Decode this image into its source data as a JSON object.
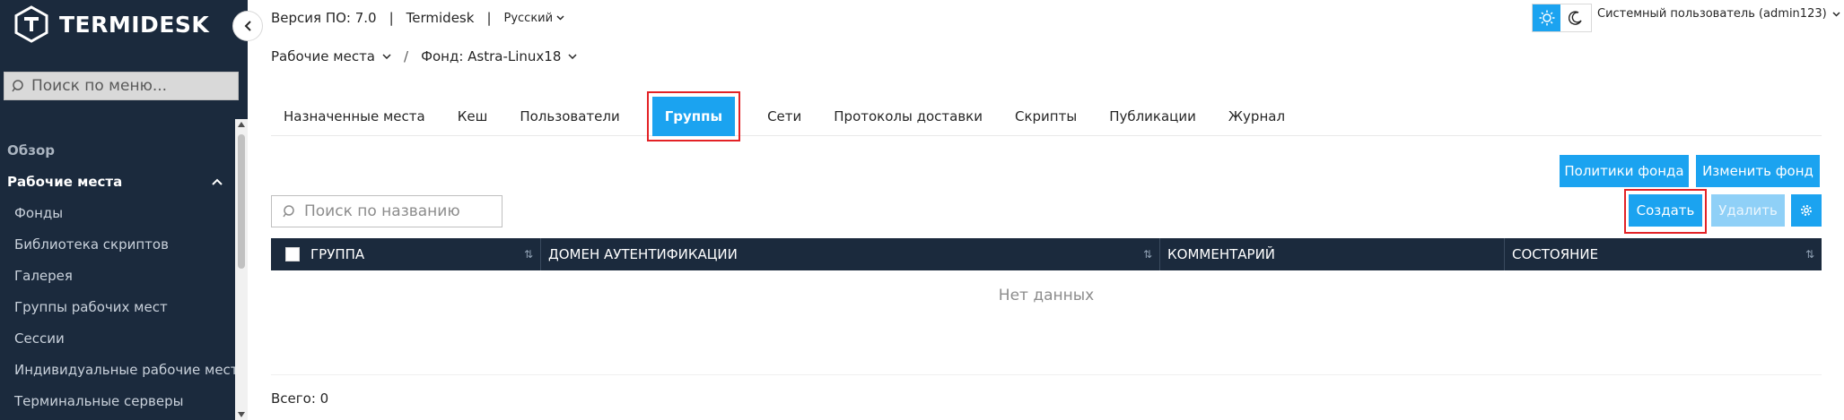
{
  "sidebar": {
    "logo_text": "TERMIDESK",
    "search_placeholder": "Поиск по меню...",
    "items": [
      {
        "label": "Обзор"
      },
      {
        "label": "Рабочие места"
      },
      {
        "label": "Фонды"
      },
      {
        "label": "Библиотека скриптов"
      },
      {
        "label": "Галерея"
      },
      {
        "label": "Группы рабочих мест"
      },
      {
        "label": "Сессии"
      },
      {
        "label": "Индивидуальные рабочие места"
      },
      {
        "label": "Терминальные серверы"
      }
    ]
  },
  "header": {
    "version": "Версия ПО: 7.0",
    "separator": "|",
    "product": "Termidesk",
    "language": "Русский",
    "user": "Системный пользователь (admin123)"
  },
  "breadcrumb": {
    "root": "Рабочие места",
    "current": "Фонд: Astra-Linux18",
    "separator": "/"
  },
  "tabs": [
    {
      "label": "Назначенные места"
    },
    {
      "label": "Кеш"
    },
    {
      "label": "Пользователи"
    },
    {
      "label": "Группы"
    },
    {
      "label": "Сети"
    },
    {
      "label": "Протоколы доставки"
    },
    {
      "label": "Скрипты"
    },
    {
      "label": "Публикации"
    },
    {
      "label": "Журнал"
    }
  ],
  "actions": {
    "policies": "Политики фонда",
    "edit": "Изменить фонд",
    "create": "Создать",
    "delete": "Удалить"
  },
  "search": {
    "placeholder": "Поиск по названию"
  },
  "table": {
    "columns": [
      "ГРУППА",
      "ДОМЕН АУТЕНТИФИКАЦИИ",
      "КОММЕНТАРИЙ",
      "СОСТОЯНИЕ"
    ],
    "empty_text": "Нет данных"
  },
  "footer": {
    "total": "Всего: 0"
  },
  "colors": {
    "accent": "#1ba3f0",
    "sidebar_bg": "#1b2a3d",
    "highlight": "#e32226"
  }
}
